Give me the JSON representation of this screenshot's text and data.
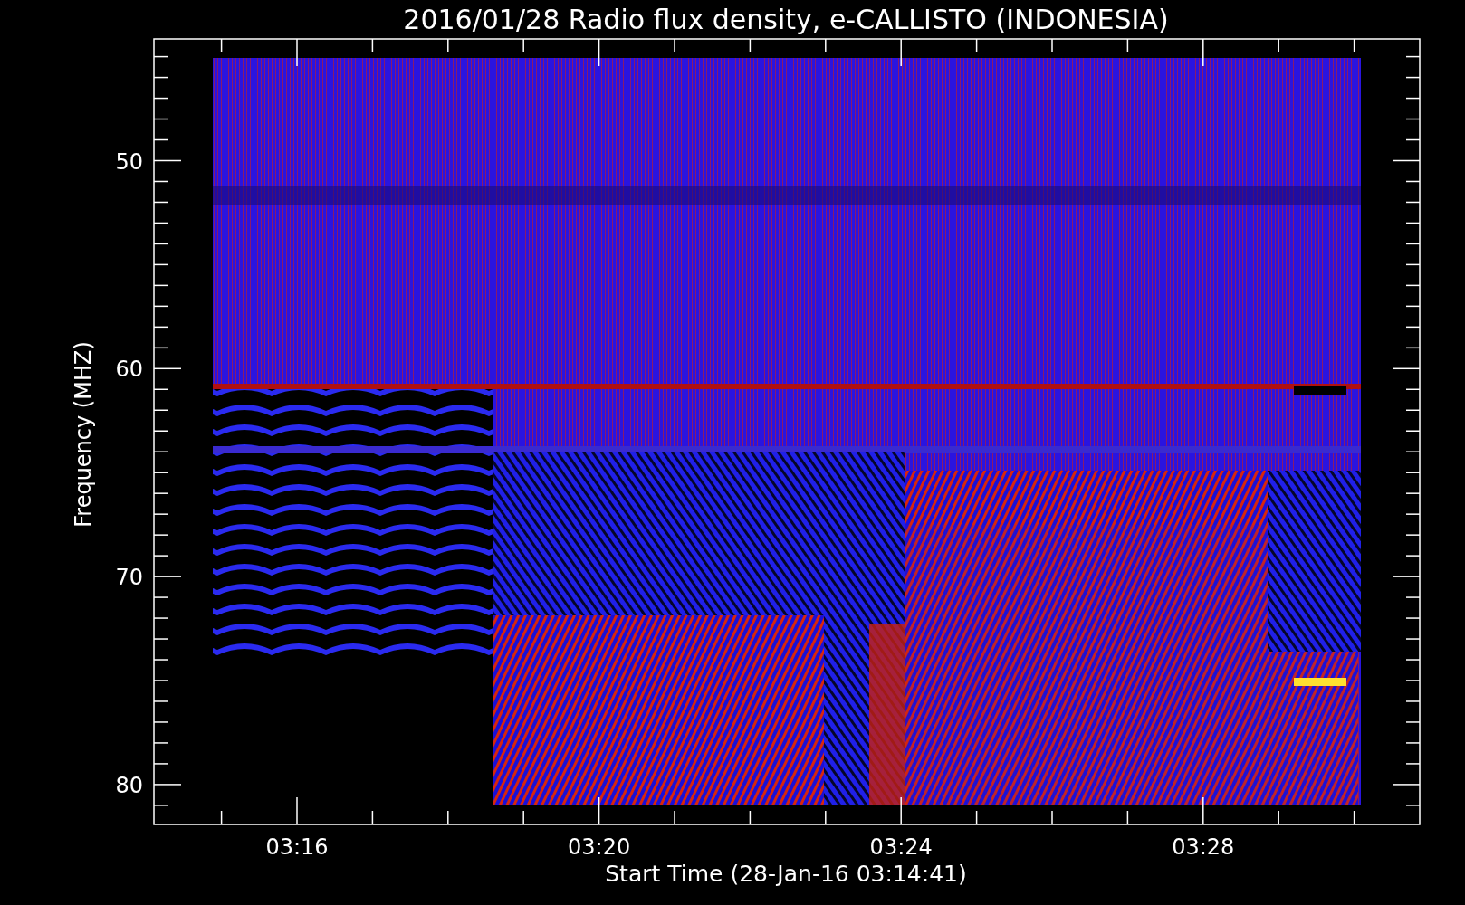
{
  "title": "2016/01/28  Radio flux density, e-CALLISTO (INDONESIA)",
  "ylabel": "Frequency (MHZ)",
  "xlabel": "Start Time (28-Jan-16 03:14:41)",
  "yticks": [
    "50",
    "60",
    "70",
    "80"
  ],
  "xticks": [
    "03:16",
    "03:20",
    "03:24",
    "03:28"
  ]
}
